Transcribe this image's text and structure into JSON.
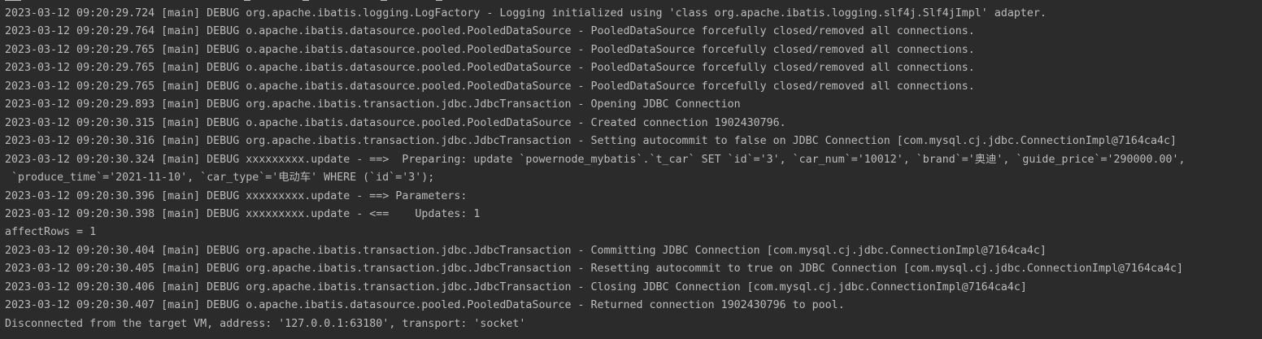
{
  "console": {
    "lines": [
      "2023-03-12 09:20:29.724 [main] DEBUG org.apache.ibatis.logging.LogFactory - Logging initialized using 'class org.apache.ibatis.logging.slf4j.Slf4jImpl' adapter.",
      "2023-03-12 09:20:29.764 [main] DEBUG o.apache.ibatis.datasource.pooled.PooledDataSource - PooledDataSource forcefully closed/removed all connections.",
      "2023-03-12 09:20:29.765 [main] DEBUG o.apache.ibatis.datasource.pooled.PooledDataSource - PooledDataSource forcefully closed/removed all connections.",
      "2023-03-12 09:20:29.765 [main] DEBUG o.apache.ibatis.datasource.pooled.PooledDataSource - PooledDataSource forcefully closed/removed all connections.",
      "2023-03-12 09:20:29.765 [main] DEBUG o.apache.ibatis.datasource.pooled.PooledDataSource - PooledDataSource forcefully closed/removed all connections.",
      "2023-03-12 09:20:29.893 [main] DEBUG org.apache.ibatis.transaction.jdbc.JdbcTransaction - Opening JDBC Connection",
      "2023-03-12 09:20:30.315 [main] DEBUG o.apache.ibatis.datasource.pooled.PooledDataSource - Created connection 1902430796.",
      "2023-03-12 09:20:30.316 [main] DEBUG org.apache.ibatis.transaction.jdbc.JdbcTransaction - Setting autocommit to false on JDBC Connection [com.mysql.cj.jdbc.ConnectionImpl@7164ca4c]",
      "2023-03-12 09:20:30.324 [main] DEBUG xxxxxxxxx.update - ==>  Preparing: update `powernode_mybatis`.`t_car` SET `id`='3', `car_num`='10012', `brand`='奥迪', `guide_price`='290000.00',",
      " `produce_time`='2021-11-10', `car_type`='电动车' WHERE (`id`='3');",
      "2023-03-12 09:20:30.396 [main] DEBUG xxxxxxxxx.update - ==> Parameters: ",
      "2023-03-12 09:20:30.398 [main] DEBUG xxxxxxxxx.update - <==    Updates: 1",
      "affectRows = 1",
      "2023-03-12 09:20:30.404 [main] DEBUG org.apache.ibatis.transaction.jdbc.JdbcTransaction - Committing JDBC Connection [com.mysql.cj.jdbc.ConnectionImpl@7164ca4c]",
      "2023-03-12 09:20:30.405 [main] DEBUG org.apache.ibatis.transaction.jdbc.JdbcTransaction - Resetting autocommit to true on JDBC Connection [com.mysql.cj.jdbc.ConnectionImpl@7164ca4c]",
      "2023-03-12 09:20:30.406 [main] DEBUG org.apache.ibatis.transaction.jdbc.JdbcTransaction - Closing JDBC Connection [com.mysql.cj.jdbc.ConnectionImpl@7164ca4c]",
      "2023-03-12 09:20:30.407 [main] DEBUG o.apache.ibatis.datasource.pooled.PooledDataSource - Returned connection 1902430796 to pool.",
      "Disconnected from the target VM, address: '127.0.0.1:63180', transport: 'socket'"
    ]
  },
  "colors": {
    "background": "#2b2b2b",
    "text": "#bbbbbb"
  }
}
